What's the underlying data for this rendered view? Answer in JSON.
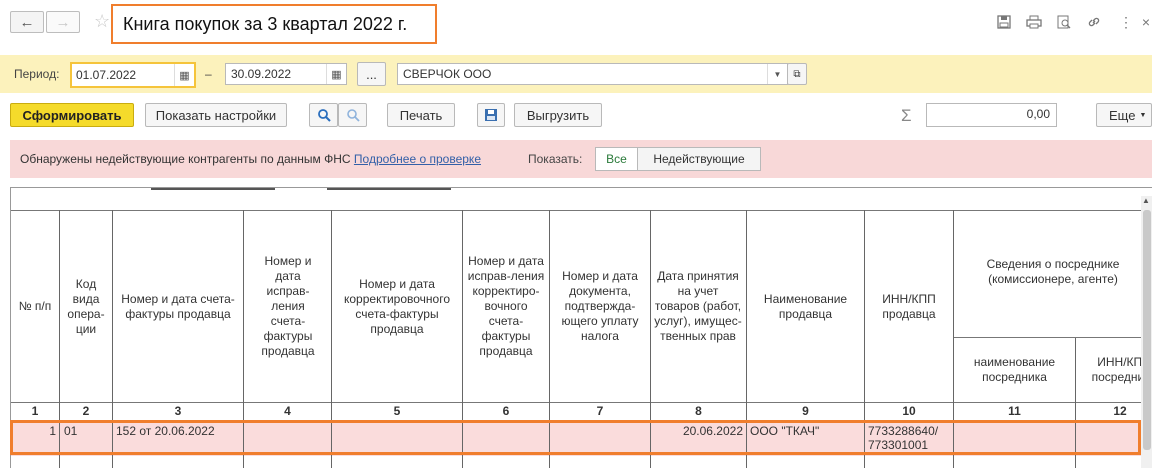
{
  "window": {
    "title": "Книга покупок за 3 квартал 2022 г.",
    "back_icon": "arrow-left",
    "forward_icon": "arrow-right",
    "favorite_icon": "star",
    "action_icons": [
      "save-icon",
      "print-icon",
      "preview-icon",
      "link-icon",
      "more-vertical-icon",
      "close-icon"
    ],
    "accent_color": "#f07e2d"
  },
  "period": {
    "label": "Период:",
    "from": "01.07.2022",
    "dash": "–",
    "to": "30.09.2022",
    "ellipsis": "...",
    "organization": "СВЕРЧОК ООО"
  },
  "toolbar": {
    "generate": "Сформировать",
    "settings": "Показать настройки",
    "print": "Печать",
    "export": "Выгрузить",
    "sum_symbol": "Σ",
    "sum_value": "0,00",
    "more": "Еще"
  },
  "alert": {
    "text": "Обнаружены недействующие контрагенты по данным ФНС",
    "link": "Подробнее о проверке",
    "show_label": "Показать:",
    "all": "Все",
    "inactive": "Недействующие"
  },
  "table": {
    "headers": [
      "№ п/п",
      "Код вида опера-ции",
      "Номер и дата счета-фактуры продавца",
      "Номер и дата исправ-ления счета-фактуры продавца",
      "Номер и дата корректировочного счета-фактуры продавца",
      "Номер и дата исправ-ления корректиро-вочного счета-фактуры продавца",
      "Номер и дата документа, подтвержда-ющего уплату налога",
      "Дата принятия на учет товаров (работ, услуг), имущес-твенных прав",
      "Наименование продавца",
      "ИНН/КПП продавца",
      "Сведения о посреднике (комиссионере, агенте)"
    ],
    "sub_headers": [
      "наименование посредника",
      "ИНН/КПП посредника"
    ],
    "column_numbers": [
      "1",
      "2",
      "3",
      "4",
      "5",
      "6",
      "7",
      "8",
      "9",
      "10",
      "11",
      "12"
    ],
    "rows": [
      {
        "n": "1",
        "code": "01",
        "invoice": "152 от 20.06.2022",
        "correction": "",
        "adj_invoice": "",
        "adj_correction": "",
        "payment_doc": "",
        "accept_date": "20.06.2022",
        "seller": "ООО \"ТКАЧ\"",
        "inn_kpp": "7733288640/ 773301001",
        "agent_name": "",
        "agent_inn": ""
      }
    ]
  }
}
